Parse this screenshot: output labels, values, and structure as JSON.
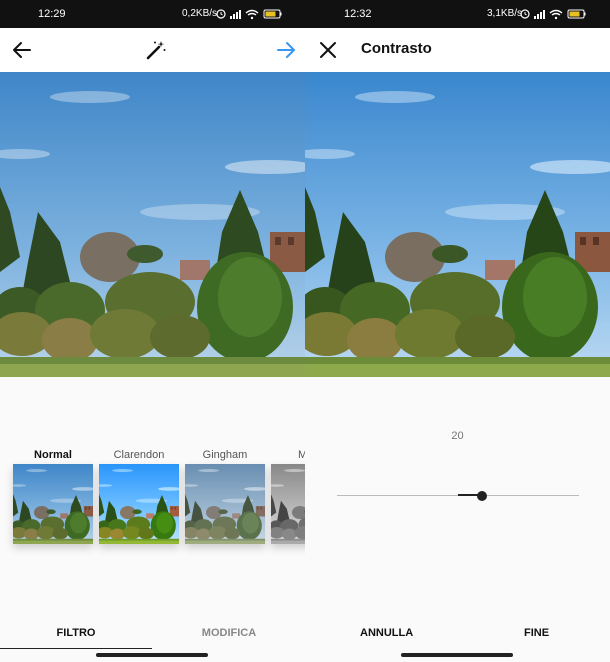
{
  "left": {
    "status": {
      "time": "12:29",
      "speed": "0,2KB/s",
      "battery": "65"
    },
    "toolbar": {
      "back_icon": "arrow-left-icon",
      "magic_icon": "magic-wand-icon",
      "next_icon": "arrow-right-icon",
      "accent": "#3897f0"
    },
    "filters": [
      {
        "label": "Normal",
        "selected": true
      },
      {
        "label": "Clarendon",
        "selected": false
      },
      {
        "label": "Gingham",
        "selected": false
      },
      {
        "label": "M",
        "selected": false
      }
    ],
    "tabs": [
      {
        "label": "FILTRO",
        "active": true
      },
      {
        "label": "MODIFICA",
        "active": false
      }
    ]
  },
  "right": {
    "status": {
      "time": "12:32",
      "speed": "3,1KB/s",
      "battery": "65"
    },
    "toolbar": {
      "close_icon": "close-icon",
      "title": "Contrasto"
    },
    "adjust": {
      "value": "20",
      "level_percent": 60
    },
    "actions": {
      "cancel": "ANNULLA",
      "done": "FINE"
    }
  }
}
